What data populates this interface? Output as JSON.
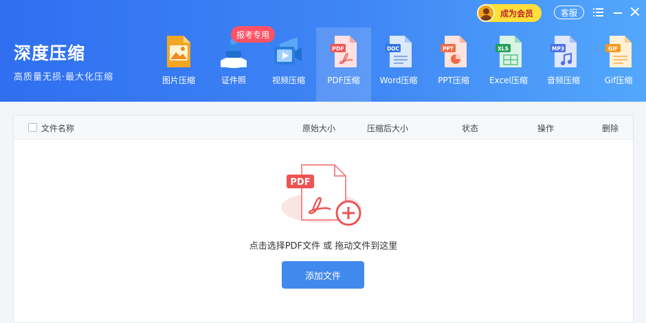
{
  "app": {
    "title": "深度压缩",
    "subtitle": "高质量无损·最大化压缩"
  },
  "topbar": {
    "vip_label": "成为会员",
    "service_label": "客服"
  },
  "tabs": [
    {
      "label": "图片压缩",
      "icon": "image-file-icon"
    },
    {
      "label": "证件照",
      "icon": "id-photo-icon",
      "badge": "报考专用"
    },
    {
      "label": "视频压缩",
      "icon": "video-file-icon"
    },
    {
      "label": "PDF压缩",
      "icon": "pdf-file-icon",
      "active": true
    },
    {
      "label": "Word压缩",
      "icon": "word-file-icon"
    },
    {
      "label": "PPT压缩",
      "icon": "ppt-file-icon"
    },
    {
      "label": "Excel压缩",
      "icon": "excel-file-icon"
    },
    {
      "label": "音频压缩",
      "icon": "mp3-file-icon"
    },
    {
      "label": "Gif压缩",
      "icon": "gif-file-icon"
    }
  ],
  "icon_text": {
    "pdf": "PDF",
    "doc": "DOC",
    "ppt": "PPT",
    "xls": "XLS",
    "mp3": "MP3",
    "gif": "GIF"
  },
  "table": {
    "columns": [
      "文件名称",
      "原始大小",
      "压缩后大小",
      "状态",
      "操作",
      "删除"
    ]
  },
  "empty": {
    "illus_label": "PDF",
    "hint": "点击选择PDF文件 或 拖动文件到这里",
    "add_button": "添加文件"
  },
  "colors": {
    "header_start": "#2f6ff0",
    "header_end": "#53a7fb",
    "vip_bg": "#ffe03b",
    "badge_bg": "#ff5266",
    "button_bg": "#4289ee",
    "pdf_red": "#f05252"
  }
}
